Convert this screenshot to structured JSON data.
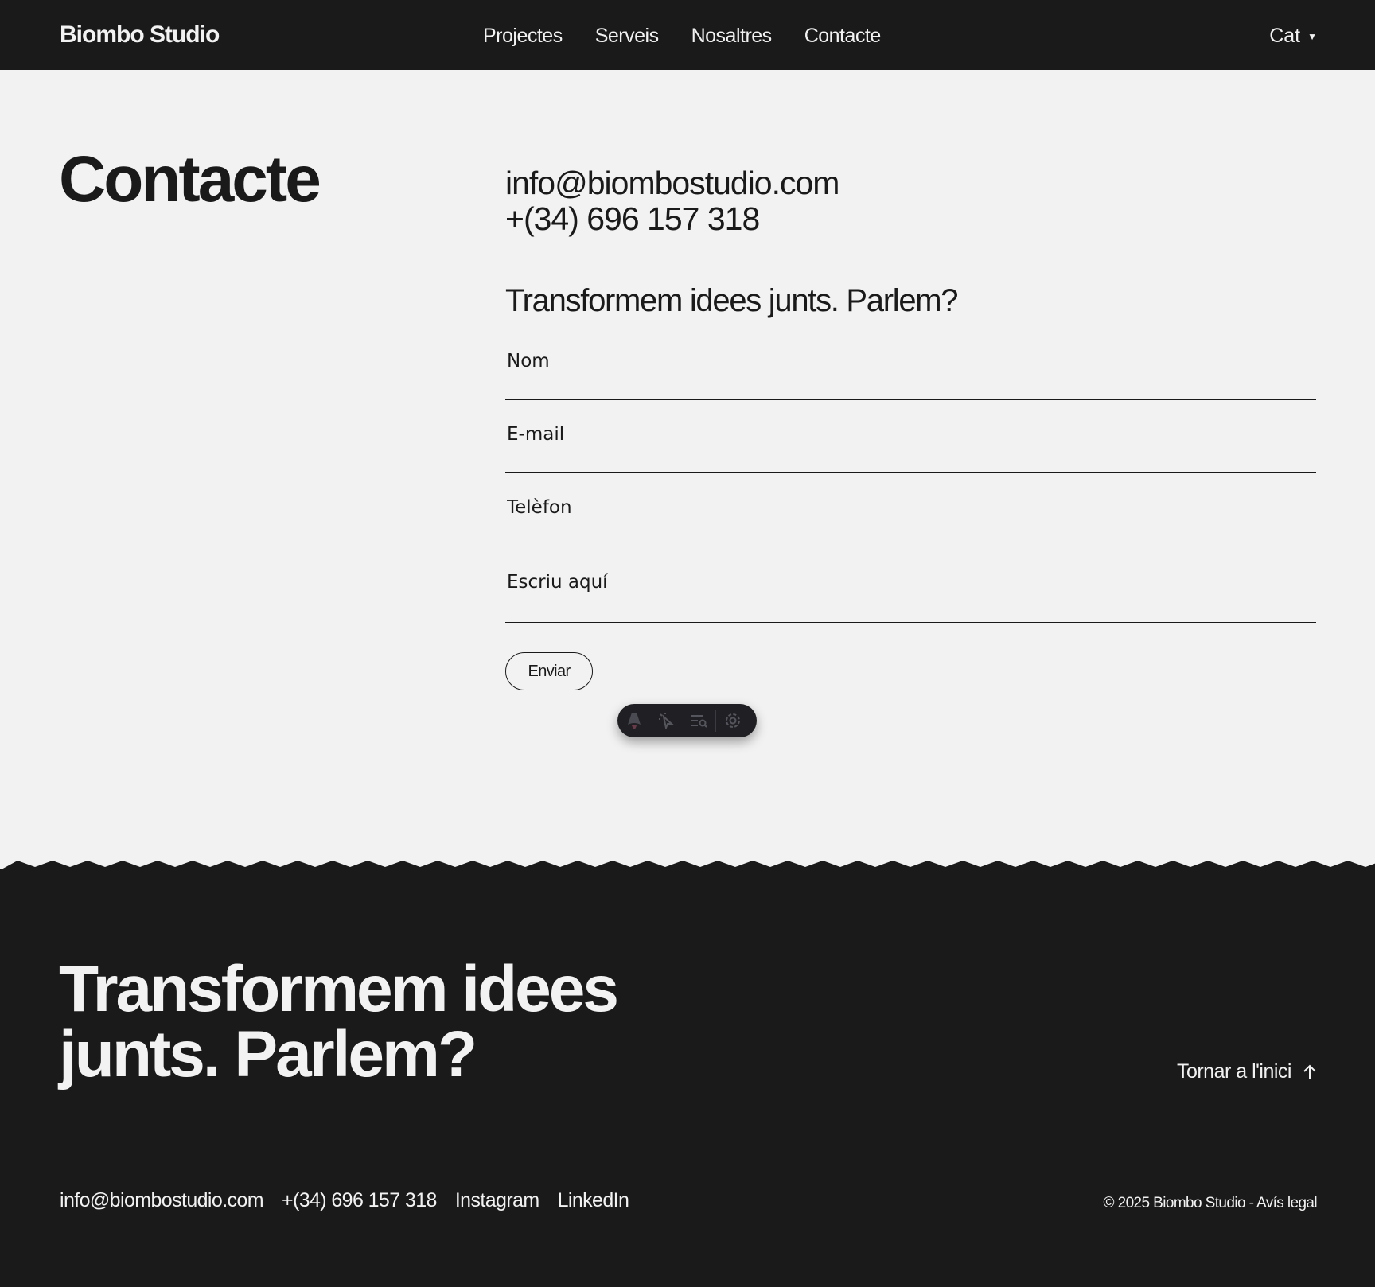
{
  "nav": {
    "brand": "Biombo Studio",
    "links": [
      "Projectes",
      "Serveis",
      "Nosaltres",
      "Contacte"
    ],
    "language": "Cat"
  },
  "main": {
    "title": "Contacte",
    "email": "info@biombostudio.com",
    "phone": "+(34) 696 157 318",
    "form_heading": "Transformem idees junts. Parlem?",
    "fields": {
      "name_placeholder": "Nom",
      "email_placeholder": "E-mail",
      "phone_placeholder": "Telèfon",
      "message_placeholder": "Escriu aquí"
    },
    "submit_label": "Enviar"
  },
  "dev_toolbar": {
    "icons": [
      "astro-logo-icon",
      "cursor-inspect-icon",
      "audit-list-icon",
      "settings-gear-icon"
    ]
  },
  "footer": {
    "heading_line1": "Transformem idees",
    "heading_line2": "junts. Parlem?",
    "back_to_top": "Tornar a l'inici",
    "links": {
      "email": "info@biombostudio.com",
      "phone": "+(34) 696 157 318",
      "instagram": "Instagram",
      "linkedin": "LinkedIn"
    },
    "copyright": "© 2025 Biombo Studio - Avís legal"
  },
  "colors": {
    "dark": "#1a1a1a",
    "light": "#f2f2f2"
  }
}
